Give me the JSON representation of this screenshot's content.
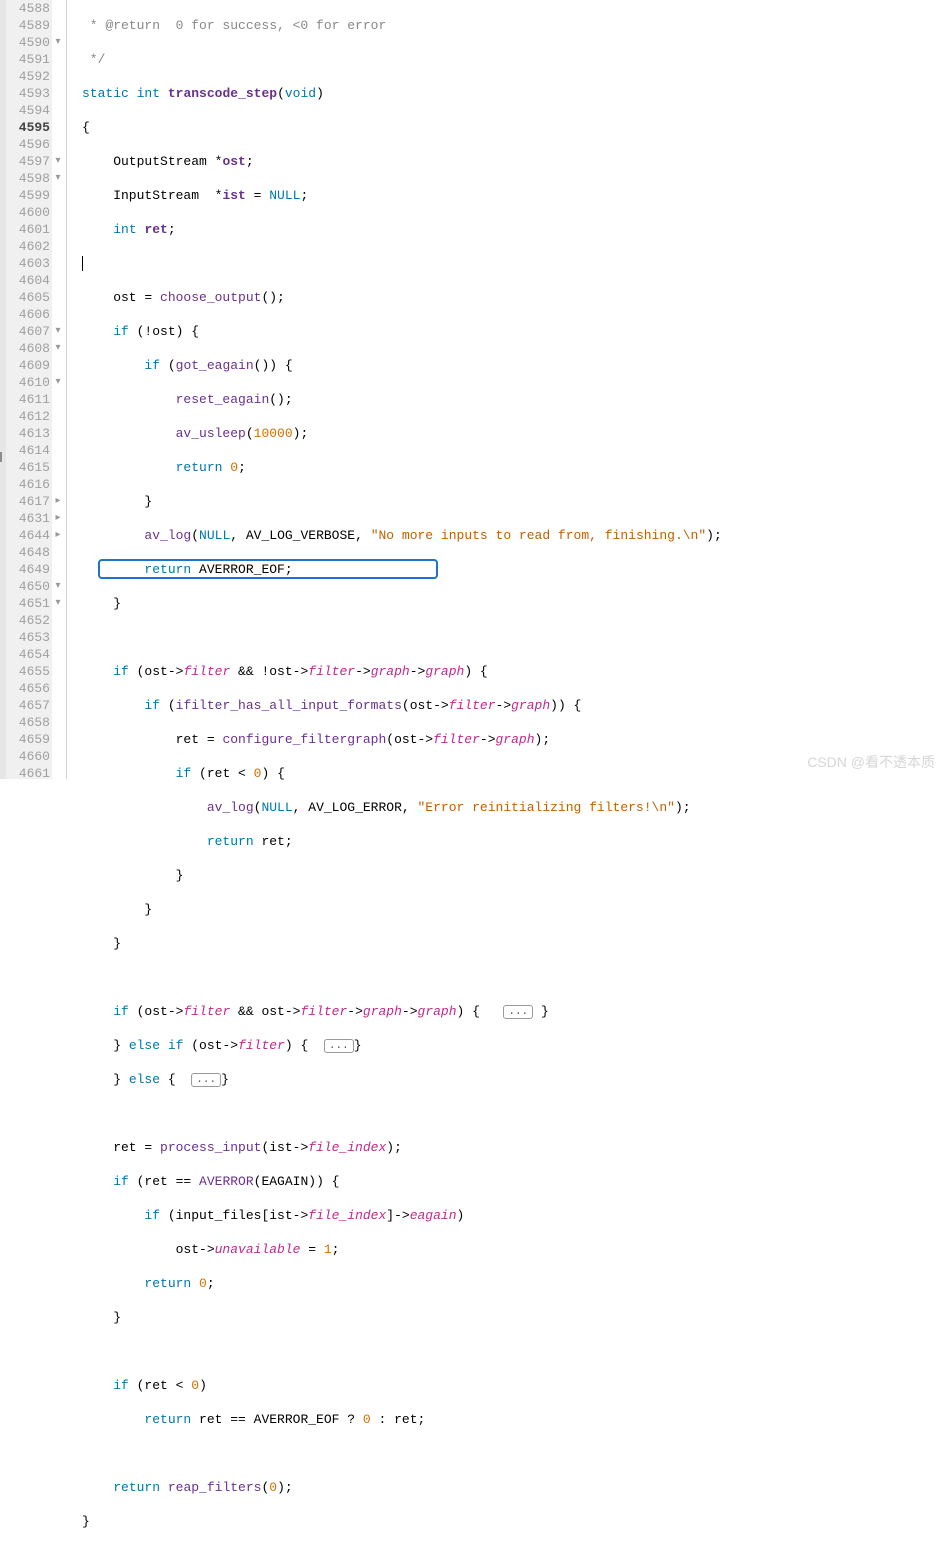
{
  "line_numbers": [
    "4588",
    "4589",
    "4590",
    "4591",
    "4592",
    "4593",
    "4594",
    "4595",
    "4596",
    "4597",
    "4598",
    "4599",
    "4600",
    "4601",
    "4602",
    "4603",
    "4604",
    "4605",
    "4606",
    "4607",
    "4608",
    "4609",
    "4610",
    "4611",
    "4612",
    "4613",
    "4614",
    "4615",
    "4616",
    "4617",
    "4631",
    "4644",
    "4648",
    "4649",
    "4650",
    "4651",
    "4652",
    "4653",
    "4654",
    "4655",
    "4656",
    "4657",
    "4658",
    "4659",
    "4660",
    "4661"
  ],
  "current_line": "4595",
  "fold_glyphs": {
    "2": "▾",
    "9": "▾",
    "10": "▾",
    "19": "▾",
    "20": "▾",
    "22": "▾",
    "29": "▸",
    "30": "▸",
    "31": "▸",
    "34": "▾",
    "35": "▾"
  },
  "fold_ellipsis": "...",
  "strings": {
    "s1": "\"No more inputs to read from, finishing.\\n\"",
    "s2": "\"Error reinitializing filters!\\n\""
  },
  "watermark": "CSDN @看不透本质",
  "code": {
    "l0": " * @return  0 for success, <0 for error",
    "l1": " */",
    "l2a": "static",
    "l2b": "int",
    "l2c": "transcode_step",
    "l2d": "(",
    "l2e": "void",
    "l2f": ")",
    "l3": "{",
    "l4a": "    OutputStream *",
    "l4b": "ost",
    "l4c": ";",
    "l5a": "    InputStream  *",
    "l5b": "ist",
    "l5c": " = ",
    "l5d": "NULL",
    "l5e": ";",
    "l6a": "    ",
    "l6b": "int",
    "l6c": " ",
    "l6d": "ret",
    "l6e": ";",
    "l8a": "    ost = ",
    "l8b": "choose_output",
    "l8c": "();",
    "l9a": "    ",
    "l9b": "if",
    "l9c": " (!ost) {",
    "l10a": "        ",
    "l10b": "if",
    "l10c": " (",
    "l10d": "got_eagain",
    "l10e": "()) {",
    "l11a": "            ",
    "l11b": "reset_eagain",
    "l11c": "();",
    "l12a": "            ",
    "l12b": "av_usleep",
    "l12c": "(",
    "l12d": "10000",
    "l12e": ");",
    "l13a": "            ",
    "l13b": "return",
    "l13c": " ",
    "l13d": "0",
    "l13e": ";",
    "l14": "        }",
    "l15a": "        ",
    "l15b": "av_log",
    "l15c": "(",
    "l15d": "NULL",
    "l15e": ", AV_LOG_VERBOSE, ",
    "l15g": ");",
    "l16a": "        ",
    "l16b": "return",
    "l16c": " AVERROR_EOF;",
    "l17": "    }",
    "l19a": "    ",
    "l19b": "if",
    "l19c": " (ost->",
    "l19d": "filter",
    "l19e": " && !ost->",
    "l19f": "filter",
    "l19g": "->",
    "l19h": "graph",
    "l19i": "->",
    "l19j": "graph",
    "l19k": ") {",
    "l20a": "        ",
    "l20b": "if",
    "l20c": " (",
    "l20d": "ifilter_has_all_input_formats",
    "l20e": "(ost->",
    "l20f": "filter",
    "l20g": "->",
    "l20h": "graph",
    "l20i": ")) {",
    "l21a": "            ret = ",
    "l21b": "configure_filtergraph",
    "l21c": "(ost->",
    "l21d": "filter",
    "l21e": "->",
    "l21f": "graph",
    "l21g": ");",
    "l22a": "            ",
    "l22b": "if",
    "l22c": " (ret < ",
    "l22d": "0",
    "l22e": ") {",
    "l23a": "                ",
    "l23b": "av_log",
    "l23c": "(",
    "l23d": "NULL",
    "l23e": ", AV_LOG_ERROR, ",
    "l23g": ");",
    "l24a": "                ",
    "l24b": "return",
    "l24c": " ret;",
    "l25": "            }",
    "l26": "        }",
    "l27": "    }",
    "l29a": "    ",
    "l29b": "if",
    "l29c": " (ost->",
    "l29d": "filter",
    "l29e": " && ost->",
    "l29f": "filter",
    "l29g": "->",
    "l29h": "graph",
    "l29i": "->",
    "l29j": "graph",
    "l29k": ") { ",
    "l30a": "    } ",
    "l30b": "else",
    "l30c": " ",
    "l30d": "if",
    "l30e": " (ost->",
    "l30f": "filter",
    "l30g": ") { ",
    "l31a": "    } ",
    "l31b": "else",
    "l31c": " { ",
    "l33a": "    ret = ",
    "l33b": "process_input",
    "l33c": "(ist->",
    "l33d": "file_index",
    "l33e": ");",
    "l34a": "    ",
    "l34b": "if",
    "l34c": " (ret == ",
    "l34d": "AVERROR",
    "l34e": "(EAGAIN)) {",
    "l35a": "        ",
    "l35b": "if",
    "l35c": " (input_files[ist->",
    "l35d": "file_index",
    "l35e": "]->",
    "l35f": "eagain",
    "l35g": ")",
    "l36a": "            ost->",
    "l36b": "unavailable",
    "l36c": " = ",
    "l36d": "1",
    "l36e": ";",
    "l37a": "        ",
    "l37b": "return",
    "l37c": " ",
    "l37d": "0",
    "l37e": ";",
    "l38": "    }",
    "l40a": "    ",
    "l40b": "if",
    "l40c": " (ret < ",
    "l40d": "0",
    "l40e": ")",
    "l41a": "        ",
    "l41b": "return",
    "l41c": " ret == AVERROR_EOF ? ",
    "l41d": "0",
    "l41e": " : ret;",
    "l43a": "    ",
    "l43b": "return",
    "l43c": " ",
    "l43d": "reap_filters",
    "l43e": "(",
    "l43f": "0",
    "l43g": ");",
    "l44": "}"
  }
}
